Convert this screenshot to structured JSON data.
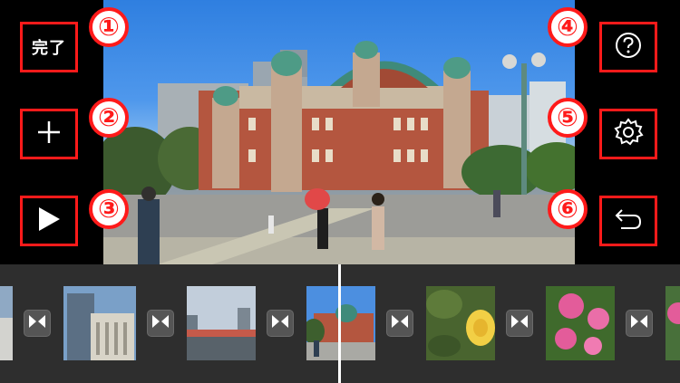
{
  "left_toolbar": {
    "done_label": "完了",
    "add_icon": "plus-icon",
    "play_icon": "play-icon"
  },
  "right_toolbar": {
    "help_icon": "question-circle-icon",
    "settings_icon": "gear-icon",
    "undo_icon": "undo-arrow-icon"
  },
  "annotations": [
    "①",
    "②",
    "③",
    "④",
    "⑤",
    "⑥"
  ],
  "timeline": {
    "clips": [
      "city-buildings",
      "office-tower",
      "bridge-skyline",
      "hall-plaza",
      "yellow-rose",
      "pink-roses",
      "pink-flower"
    ],
    "transition_icon": "bowtie-transition-icon"
  },
  "colors": {
    "annotation_red": "#ff1a1a",
    "background": "#000000",
    "timeline_bg": "#2e2e2e",
    "playhead": "#ffffff"
  }
}
